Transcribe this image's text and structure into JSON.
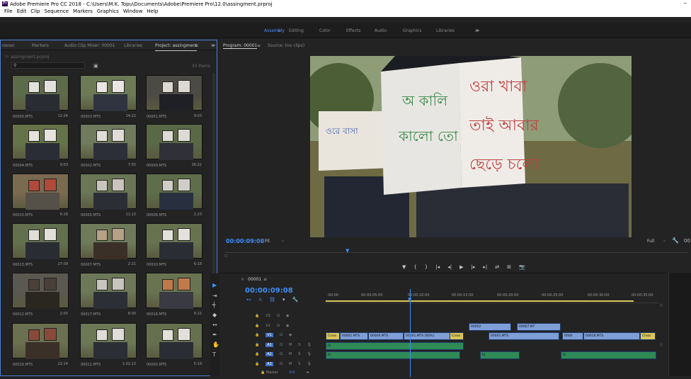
{
  "titlebar": {
    "title": "Adobe Premiere Pro CC 2018 - C:\\Users\\M.K. Topu\\Documents\\Adobe\\Premiere Pro\\12.0\\assingment.prproj",
    "minimize": "–"
  },
  "menu": [
    "File",
    "Edit",
    "Clip",
    "Sequence",
    "Markers",
    "Graphics",
    "Window",
    "Help"
  ],
  "workspaces": [
    "Assembly",
    "Editing",
    "Color",
    "Effects",
    "Audio",
    "Graphics",
    "Libraries"
  ],
  "workspace_active": "Assembly",
  "more_glyph": "≫",
  "leftpanel": {
    "tabs": [
      "owser",
      "Markers",
      "Audio Clip Mixer: 00001",
      "Libraries",
      "Project: assingment",
      "≫"
    ],
    "active_tab": "Project: assingment",
    "project_file": "assingment.prproj",
    "items_count": "33 Items",
    "clips": [
      {
        "name": "00000.MTS",
        "dur": "12:24"
      },
      {
        "name": "00003.MTS",
        "dur": "14:22"
      },
      {
        "name": "00001.MTS",
        "dur": "9:03"
      },
      {
        "name": "00004.MTS",
        "dur": "9:03"
      },
      {
        "name": "00002.MTS",
        "dur": "7:05"
      },
      {
        "name": "00009.MTS",
        "dur": "26:22"
      },
      {
        "name": "00015.MTS",
        "dur": "6:18"
      },
      {
        "name": "00005.MTS",
        "dur": "11:13"
      },
      {
        "name": "00006.MTS",
        "dur": "2:23"
      },
      {
        "name": "00013.MTS",
        "dur": "27:09"
      },
      {
        "name": "00007.MTS",
        "dur": "2:21"
      },
      {
        "name": "00010.MTS",
        "dur": "6:18"
      },
      {
        "name": "00012.MTS",
        "dur": "2:05"
      },
      {
        "name": "00017.MTS",
        "dur": "8:00"
      },
      {
        "name": "00018.MTS",
        "dur": "9:15"
      },
      {
        "name": "00016.MTS",
        "dur": "22:14"
      },
      {
        "name": "00011.MTS",
        "dur": "1:02:22"
      },
      {
        "name": "00000.MTS",
        "dur": "5:19"
      }
    ]
  },
  "program": {
    "tab": "Program: 00001",
    "source_tab": "Source: (no clips)",
    "timecode": "00:00:09:08",
    "fit": "Fit",
    "full": "Full",
    "tc_right": "00",
    "controls": [
      "▼",
      "{",
      "}",
      "|◂",
      "◂|",
      "▶",
      "|▸",
      "▸|",
      "⇄",
      "⊞",
      "⊟",
      "📷"
    ]
  },
  "timeline": {
    "seq_name": "00001",
    "timecode": "00:00:09:08",
    "ruler": [
      ":00:00",
      "00:00:05:00",
      "00:00:10:00",
      "00:00:15:00",
      "00:00:20:00",
      "00:00:25:00",
      "00:00:30:00",
      "00:00:35:00"
    ],
    "tracks": [
      "V3",
      "V2",
      "V1",
      "A1",
      "A2",
      "A3"
    ],
    "master": "Master",
    "master_val": "0.0",
    "clips": {
      "v2a": "00002",
      "v2b": "00007.MT",
      "v1a": "Cross",
      "v1b": "00001.MTS",
      "v1c": "00000.MTS",
      "v1d": "00001.MTS [60%]",
      "v1e": "Cross",
      "v1f": "00001.MTS",
      "v1g": "0000",
      "v1h": "00018.MTS",
      "v1i": "Cross",
      "a1a": "fx",
      "a2a": "fx",
      "a2b": "fx",
      "a2c": "fx"
    }
  },
  "colors": {
    "accent": "#3e8ef7",
    "clip_video": "#7e9ed6",
    "clip_audio": "#2f8a55"
  }
}
